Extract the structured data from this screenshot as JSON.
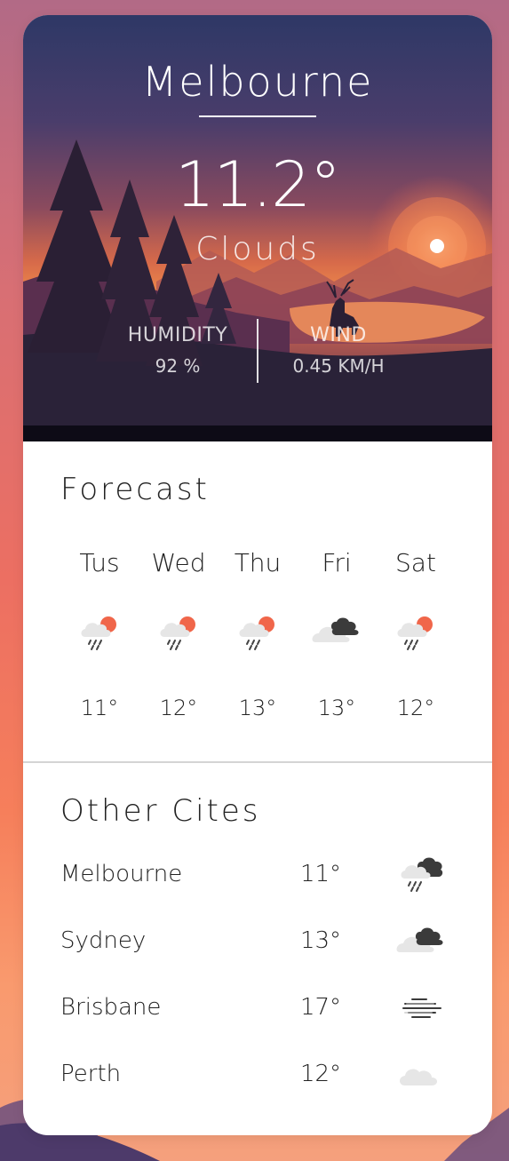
{
  "current": {
    "city": "Melbourne",
    "temperature": "11.2°",
    "condition": "Clouds",
    "humidity_label": "HUMIDITY",
    "humidity_value": "92 %",
    "wind_label": "WIND",
    "wind_value": "0.45 KM/H"
  },
  "forecast": {
    "title": "Forecast",
    "days": [
      {
        "day": "Tus",
        "temp": "11°",
        "icon": "rain-sun-icon"
      },
      {
        "day": "Wed",
        "temp": "12°",
        "icon": "rain-sun-icon"
      },
      {
        "day": "Thu",
        "temp": "13°",
        "icon": "rain-sun-icon"
      },
      {
        "day": "Fri",
        "temp": "13°",
        "icon": "dark-clouds-icon"
      },
      {
        "day": "Sat",
        "temp": "12°",
        "icon": "rain-sun-icon"
      }
    ]
  },
  "other_cities": {
    "title": "Other Cites",
    "cities": [
      {
        "name": "Melbourne",
        "temp": "11°",
        "icon": "rain-dark-cloud-icon"
      },
      {
        "name": "Sydney",
        "temp": "13°",
        "icon": "dark-clouds-icon"
      },
      {
        "name": "Brisbane",
        "temp": "17°",
        "icon": "fog-icon"
      },
      {
        "name": "Perth",
        "temp": "12°",
        "icon": "cloud-icon"
      }
    ]
  },
  "colors": {
    "sun_accent": "#f0664a",
    "dark_cloud": "#3b3b3b",
    "light_cloud": "#e6e6e6"
  }
}
